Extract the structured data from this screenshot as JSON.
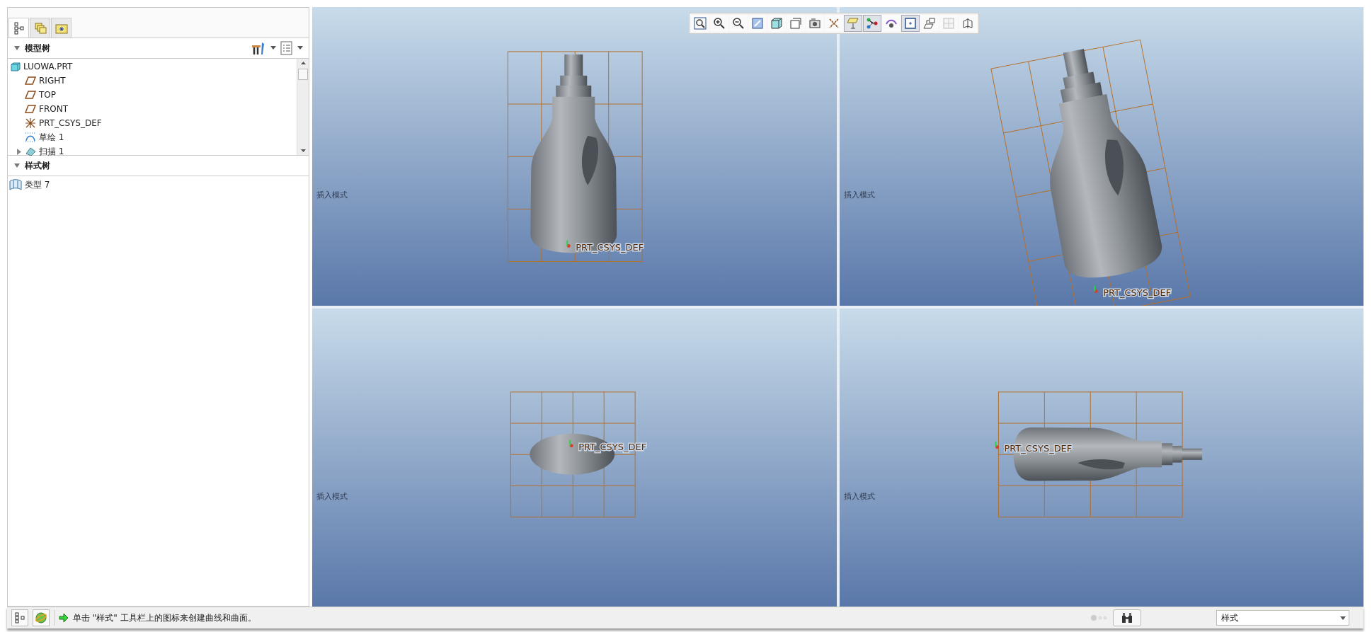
{
  "panel_tabs": [
    {
      "kind": "tree",
      "selected": true
    },
    {
      "kind": "layers",
      "selected": false
    },
    {
      "kind": "folder",
      "selected": false
    }
  ],
  "model_tree": {
    "title": "模型树",
    "expanded": true,
    "items": [
      {
        "label": "LUOWA.PRT",
        "kind": "part",
        "children": [
          {
            "label": "RIGHT",
            "kind": "plane"
          },
          {
            "label": "TOP",
            "kind": "plane"
          },
          {
            "label": "FRONT",
            "kind": "plane"
          },
          {
            "label": "PRT_CSYS_DEF",
            "kind": "csys"
          },
          {
            "label": "草绘 1",
            "kind": "sketch"
          },
          {
            "label": "扫描 1",
            "kind": "sweep",
            "expanded": false
          }
        ]
      }
    ]
  },
  "style_tree": {
    "title": "样式树",
    "expanded": true,
    "items": [
      {
        "label": "类型 7",
        "kind": "surface"
      }
    ]
  },
  "toolbar": [
    {
      "kind": "refit",
      "on": false
    },
    {
      "kind": "zoom-in",
      "on": false
    },
    {
      "kind": "zoom-out",
      "on": false
    },
    {
      "kind": "repaint",
      "on": false
    },
    {
      "kind": "display-style",
      "on": false
    },
    {
      "kind": "saved-views",
      "on": false
    },
    {
      "kind": "camera",
      "on": false
    },
    {
      "kind": "datum-display",
      "on": false
    },
    {
      "kind": "plane-display",
      "on": true
    },
    {
      "kind": "point-display",
      "on": true
    },
    {
      "kind": "spin-center",
      "on": false
    },
    {
      "kind": "view-window",
      "on": true
    },
    {
      "kind": "active-plane",
      "on": false
    },
    {
      "kind": "grid",
      "on": false
    },
    {
      "kind": "datum-plane",
      "on": false
    }
  ],
  "viewports": [
    {
      "kind": "front",
      "mode_label": "插入模式",
      "csys_label": "PRT_CSYS_DEF"
    },
    {
      "kind": "iso",
      "mode_label": "插入模式",
      "csys_label": "PRT_CSYS_DEF"
    },
    {
      "kind": "top",
      "mode_label": "插入模式",
      "csys_label": "PRT_CSYS_DEF"
    },
    {
      "kind": "side",
      "mode_label": "插入模式",
      "csys_label": "PRT_CSYS_DEF"
    }
  ],
  "status_bar": {
    "message": "单击 \"样式\" 工具栏上的图标来创建曲线和曲面。",
    "filter": "样式"
  }
}
